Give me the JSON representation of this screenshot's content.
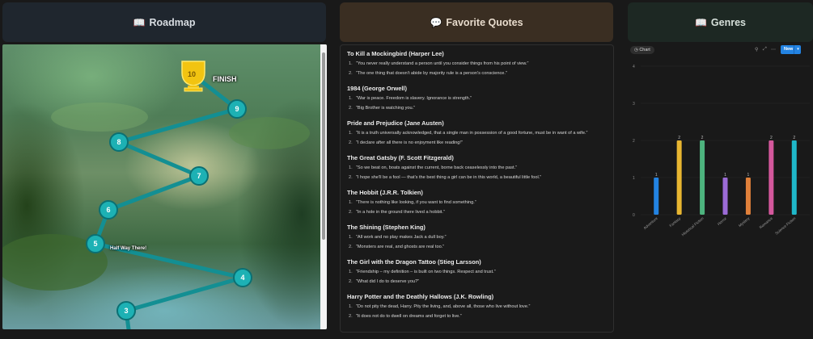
{
  "headers": {
    "roadmap": {
      "icon": "📖",
      "title": "Roadmap"
    },
    "quotes": {
      "icon": "💬",
      "title": "Favorite Quotes"
    },
    "genres": {
      "icon": "📖",
      "title": "Genres"
    }
  },
  "roadmap": {
    "finish_label": "FINISH",
    "halfway_label": "Half Way There!",
    "nodes": [
      "3",
      "4",
      "5",
      "6",
      "7",
      "8",
      "9",
      "10"
    ]
  },
  "quotes": [
    {
      "title": "To Kill a Mockingbird (Harper Lee)",
      "quotes": [
        "“You never really understand a person until you consider things from his point of view.”",
        "“The one thing that doesn't abide by majority rule is a person's conscience.”"
      ]
    },
    {
      "title": "1984 (George Orwell)",
      "quotes": [
        "“War is peace. Freedom is slavery. Ignorance is strength.”",
        "“Big Brother is watching you.”"
      ]
    },
    {
      "title": "Pride and Prejudice (Jane Austen)",
      "quotes": [
        "“It is a truth universally acknowledged, that a single man in possession of a good fortune, must be in want of a wife.”",
        "“I declare after all there is no enjoyment like reading!”"
      ]
    },
    {
      "title": "The Great Gatsby (F. Scott Fitzgerald)",
      "quotes": [
        "“So we beat on, boats against the current, borne back ceaselessly into the past.”",
        "“I hope she'll be a fool — that's the best thing a girl can be in this world, a beautiful little fool.”"
      ]
    },
    {
      "title": "The Hobbit (J.R.R. Tolkien)",
      "quotes": [
        "“There is nothing like looking, if you want to find something.”",
        "“In a hole in the ground there lived a hobbit.”"
      ]
    },
    {
      "title": "The Shining (Stephen King)",
      "quotes": [
        "“All work and no play makes Jack a dull boy.”",
        "“Monsters are real, and ghosts are real too.”"
      ]
    },
    {
      "title": "The Girl with the Dragon Tattoo (Stieg Larsson)",
      "quotes": [
        "“Friendship – my definition – is built on two things. Respect and trust.”",
        "“What did I do to deserve you?”"
      ]
    },
    {
      "title": "Harry Potter and the Deathly Hallows (J.K. Rowling)",
      "quotes": [
        "“Do not pity the dead, Harry. Pity the living, and, above all, those who live without love.”",
        "“It does not do to dwell on dreams and forget to live.”"
      ]
    }
  ],
  "genres_toolbar": {
    "chip": "Chart",
    "new_label": "New"
  },
  "chart_data": {
    "type": "bar",
    "categories": [
      "Adventure",
      "Fantasy",
      "Historical Fiction",
      "Horror",
      "Mystery",
      "Romance",
      "Science Fiction"
    ],
    "values": [
      1,
      2,
      2,
      1,
      1,
      2,
      2
    ],
    "colors": [
      "#2383e2",
      "#e8b631",
      "#4db37e",
      "#9b6bd6",
      "#e0803a",
      "#d4589c",
      "#1fb7c9"
    ],
    "ylim": [
      0,
      4
    ],
    "yticks": [
      0,
      1,
      2,
      3,
      4
    ],
    "data_labels": [
      "1",
      "2",
      "2",
      "1",
      "1",
      "2",
      "2"
    ]
  }
}
